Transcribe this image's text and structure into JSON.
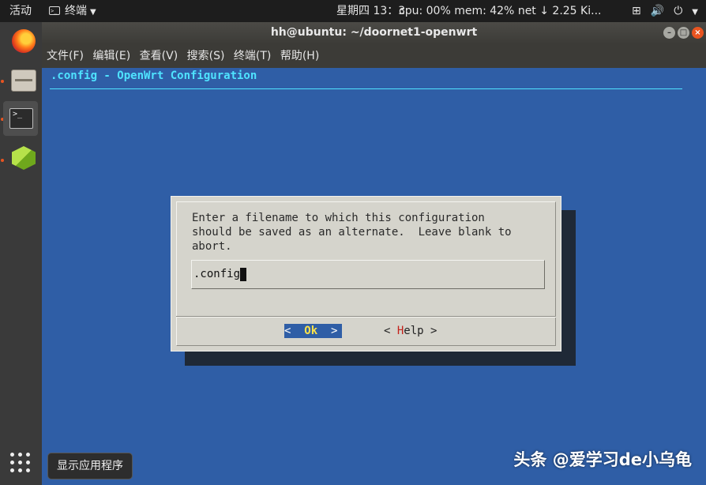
{
  "topbar": {
    "activities": "活动",
    "app_name": "终端",
    "clock": "星期四 13：3",
    "sysmon": "cpu: 00% mem: 42% net ↓  2.25 Ki...",
    "tray_icons": [
      "network-icon",
      "volume-icon",
      "power-icon"
    ]
  },
  "dock": {
    "items": [
      "firefox-icon",
      "files-icon",
      "terminal-icon",
      "box-icon"
    ],
    "show_apps_tooltip": "显示应用程序"
  },
  "window": {
    "title": "hh@ubuntu: ~/doornet1-openwrt",
    "menu": [
      "文件(F)",
      "编辑(E)",
      "查看(V)",
      "搜索(S)",
      "终端(T)",
      "帮助(H)"
    ]
  },
  "terminal": {
    "header": ".config - OpenWrt Configuration",
    "dialog": {
      "prompt": "Enter a filename to which this configuration\nshould be saved as an alternate.  Leave blank to\nabort.",
      "input_value": ".config",
      "ok_left": "<  ",
      "ok_label": "Ok",
      "ok_right": "  >",
      "help_left": "< ",
      "help_hotkey": "H",
      "help_rest": "elp >"
    }
  },
  "watermark": "头条 @爱学习de小乌龟",
  "colors": {
    "terminal_bg": "#2f5ea6",
    "header_text": "#4fe3ff",
    "dialog_bg": "#d5d4cc",
    "accent": "#e95420"
  }
}
